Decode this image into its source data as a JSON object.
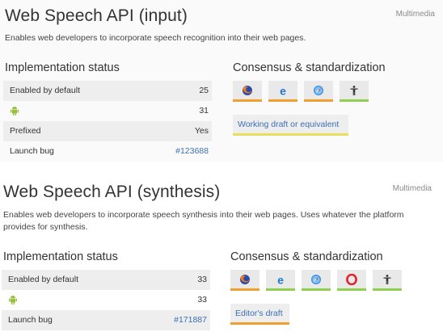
{
  "features": [
    {
      "title": "Web Speech API (input)",
      "category": "Multimedia",
      "description": "Enables web developers to incorporate speech recognition into their web pages.",
      "impl_heading": "Implementation status",
      "consensus_heading": "Consensus & standardization",
      "rows": [
        {
          "label": "Enabled by default",
          "value": "25"
        },
        {
          "label": "",
          "value": "31"
        },
        {
          "label": "Prefixed",
          "value": "Yes"
        },
        {
          "label": "Launch bug",
          "value": "#123688"
        }
      ],
      "spec_label": "Working draft or equivalent"
    },
    {
      "title": "Web Speech API (synthesis)",
      "category": "Multimedia",
      "description_line1": "Enables web developers to incorporate speech synthesis into their web pages. Uses whatever the platform",
      "description_line2": "provides for synthesis.",
      "impl_heading": "Implementation status",
      "consensus_heading": "Consensus & standardization",
      "rows": [
        {
          "label": "Enabled by default",
          "value": "33"
        },
        {
          "label": "",
          "value": "33"
        },
        {
          "label": "Launch bug",
          "value": "#171887"
        }
      ],
      "spec_label": "Editor's draft"
    }
  ],
  "icons": {
    "android": "android-icon",
    "firefox": "firefox-icon",
    "edge": "edge-icon",
    "safari": "safari-icon",
    "opera": "opera-icon",
    "webdev": "web-developers-icon"
  },
  "colors": {
    "positive": "#8fd14f",
    "mixed": "#f0a030",
    "spec_draft": "#e8e05a",
    "link": "#3b6fb6",
    "android_green": "#97c03d"
  }
}
